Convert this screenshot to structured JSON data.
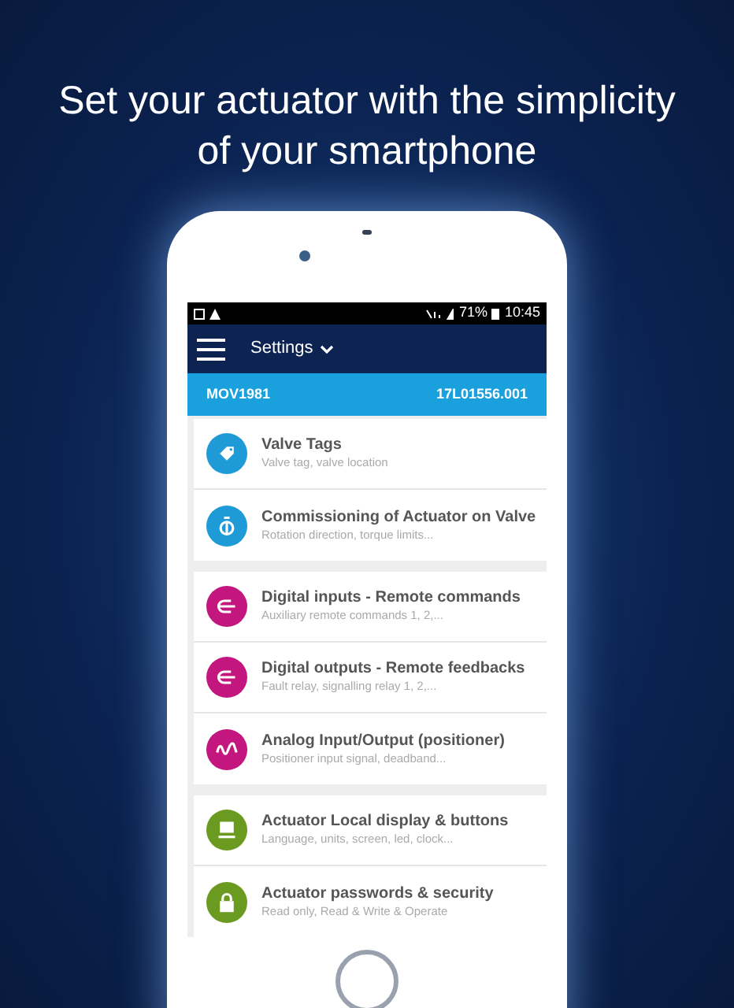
{
  "headline": "Set your actuator with the simplicity of your smartphone",
  "status_bar": {
    "battery": "71%",
    "time": "10:45"
  },
  "app_bar": {
    "title": "Settings"
  },
  "device_bar": {
    "name": "MOV1981",
    "serial": "17L01556.001"
  },
  "sections": [
    {
      "items": [
        {
          "kind": "tag",
          "color": "#1e9ad6",
          "title": "Valve Tags",
          "subtitle": "Valve tag, valve location"
        },
        {
          "kind": "valve",
          "color": "#1e9ad6",
          "title": "Commissioning of Actuator on Valve",
          "subtitle": "Rotation direction, torque limits..."
        }
      ]
    },
    {
      "items": [
        {
          "kind": "plug",
          "color": "#c4167f",
          "title": "Digital inputs - Remote commands",
          "subtitle": "Auxiliary remote commands 1, 2,..."
        },
        {
          "kind": "plug",
          "color": "#c4167f",
          "title": "Digital outputs - Remote feedbacks",
          "subtitle": "Fault relay, signalling relay 1, 2,..."
        },
        {
          "kind": "wave",
          "color": "#c4167f",
          "title": "Analog Input/Output (positioner)",
          "subtitle": "Positioner input signal, deadband..."
        }
      ]
    },
    {
      "items": [
        {
          "kind": "display",
          "color": "#6a9a1f",
          "title": "Actuator Local display & buttons",
          "subtitle": "Language, units, screen, led, clock..."
        },
        {
          "kind": "lock",
          "color": "#6a9a1f",
          "title": "Actuator passwords & security",
          "subtitle": "Read only, Read & Write & Operate"
        }
      ]
    }
  ]
}
